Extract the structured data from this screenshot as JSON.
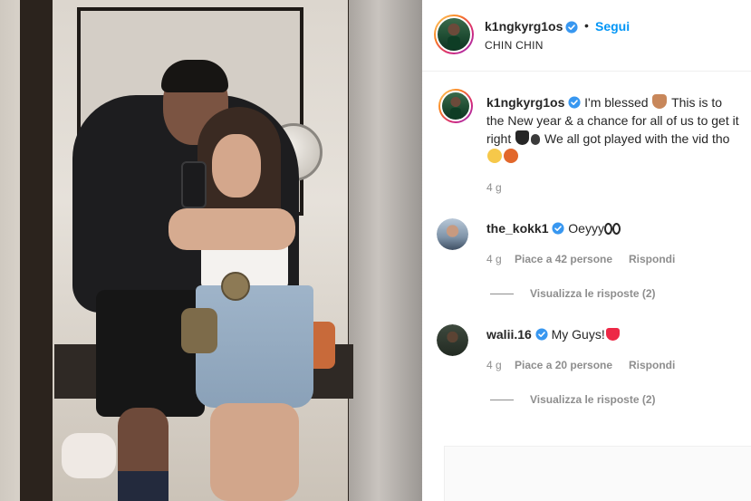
{
  "post": {
    "author": "k1ngkyrg1os",
    "follow_label": "Segui",
    "separator": "•",
    "location": "CHIN CHIN"
  },
  "caption": {
    "user": "k1ngkyrg1os",
    "part1": "I'm blessed",
    "part2": "This is to the New year & a chance for all of us to get it right",
    "part3": "We all got played with the vid tho",
    "time": "4 g"
  },
  "comments": [
    {
      "user": "the_kokk1",
      "text": "Oeyyy",
      "time": "4 g",
      "likes": "Piace a 42 persone",
      "reply_label": "Rispondi",
      "view_replies": "Visualizza le risposte (2)"
    },
    {
      "user": "walii.16",
      "text": "My Guys!",
      "time": "4 g",
      "likes": "Piace a 20 persone",
      "reply_label": "Rispondi",
      "view_replies": "Visualizza le risposte (2)"
    }
  ],
  "colors": {
    "link": "#0095f6",
    "verified": "#3897f0",
    "muted": "#8e8e8e",
    "text": "#262626"
  },
  "icons": {
    "verified": "verified-badge-icon",
    "emojis": [
      "praying-hands",
      "black-heart",
      "speaking-head",
      "laughing-face",
      "basketball",
      "eyes",
      "red-heart"
    ]
  }
}
